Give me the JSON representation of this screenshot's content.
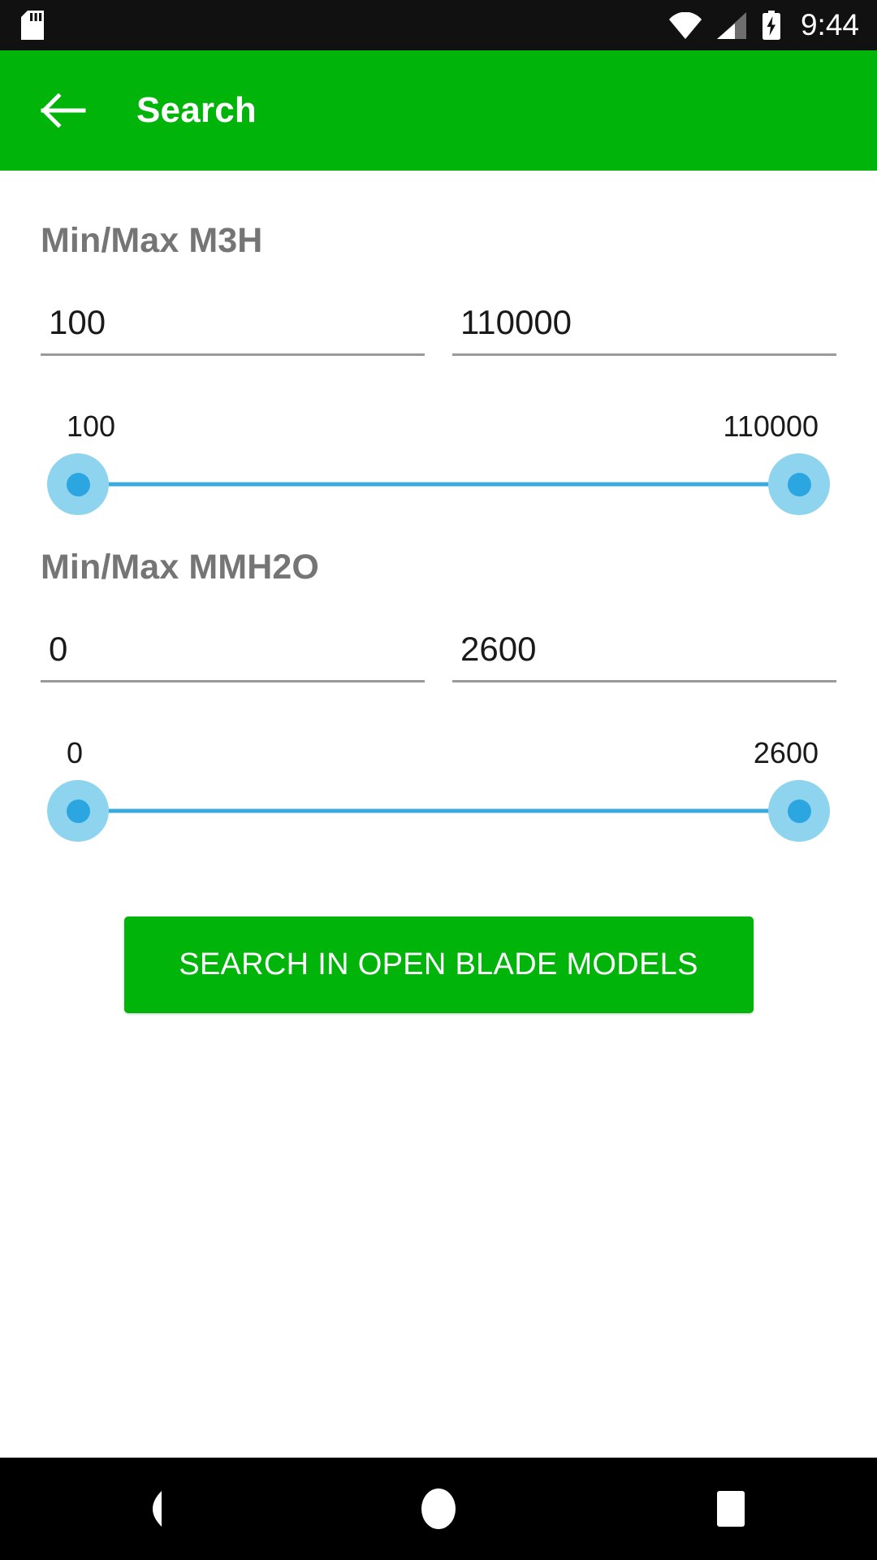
{
  "status_bar": {
    "time": "9:44",
    "icons": [
      "sd-card-icon",
      "wifi-icon",
      "cellular-signal-icon",
      "battery-charging-icon"
    ],
    "background": "#111111"
  },
  "app_bar": {
    "title": "Search",
    "back_icon": "back-arrow-icon",
    "background": "#00b40a",
    "text_color": "#ffffff"
  },
  "sections": [
    {
      "title": "Min/Max M3H",
      "min_input": {
        "value": "100",
        "placeholder": "Min"
      },
      "max_input": {
        "value": "110000",
        "placeholder": "Max"
      },
      "slider": {
        "min_label": "100",
        "max_label": "110000",
        "min_value": 100,
        "max_value": 110000,
        "range_start": 100,
        "range_end": 110000,
        "track_color": "#3aa9dd",
        "thumb_halo_color": "#8ed4ee",
        "thumb_core_color": "#2ba6e0"
      }
    },
    {
      "title": "Min/Max MMH2O",
      "min_input": {
        "value": "0",
        "placeholder": "Min"
      },
      "max_input": {
        "value": "2600",
        "placeholder": "Max"
      },
      "slider": {
        "min_label": "0",
        "max_label": "2600",
        "min_value": 0,
        "max_value": 2600,
        "range_start": 0,
        "range_end": 2600,
        "track_color": "#3aa9dd",
        "thumb_halo_color": "#8ed4ee",
        "thumb_core_color": "#2ba6e0"
      }
    }
  ],
  "primary_action": {
    "label": "SEARCH IN OPEN BLADE MODELS",
    "background": "#00b40a",
    "text_color": "#ffffff"
  },
  "nav_bar": {
    "background": "#000000",
    "buttons": [
      "back-triangle-icon",
      "home-circle-icon",
      "recents-square-icon"
    ]
  }
}
